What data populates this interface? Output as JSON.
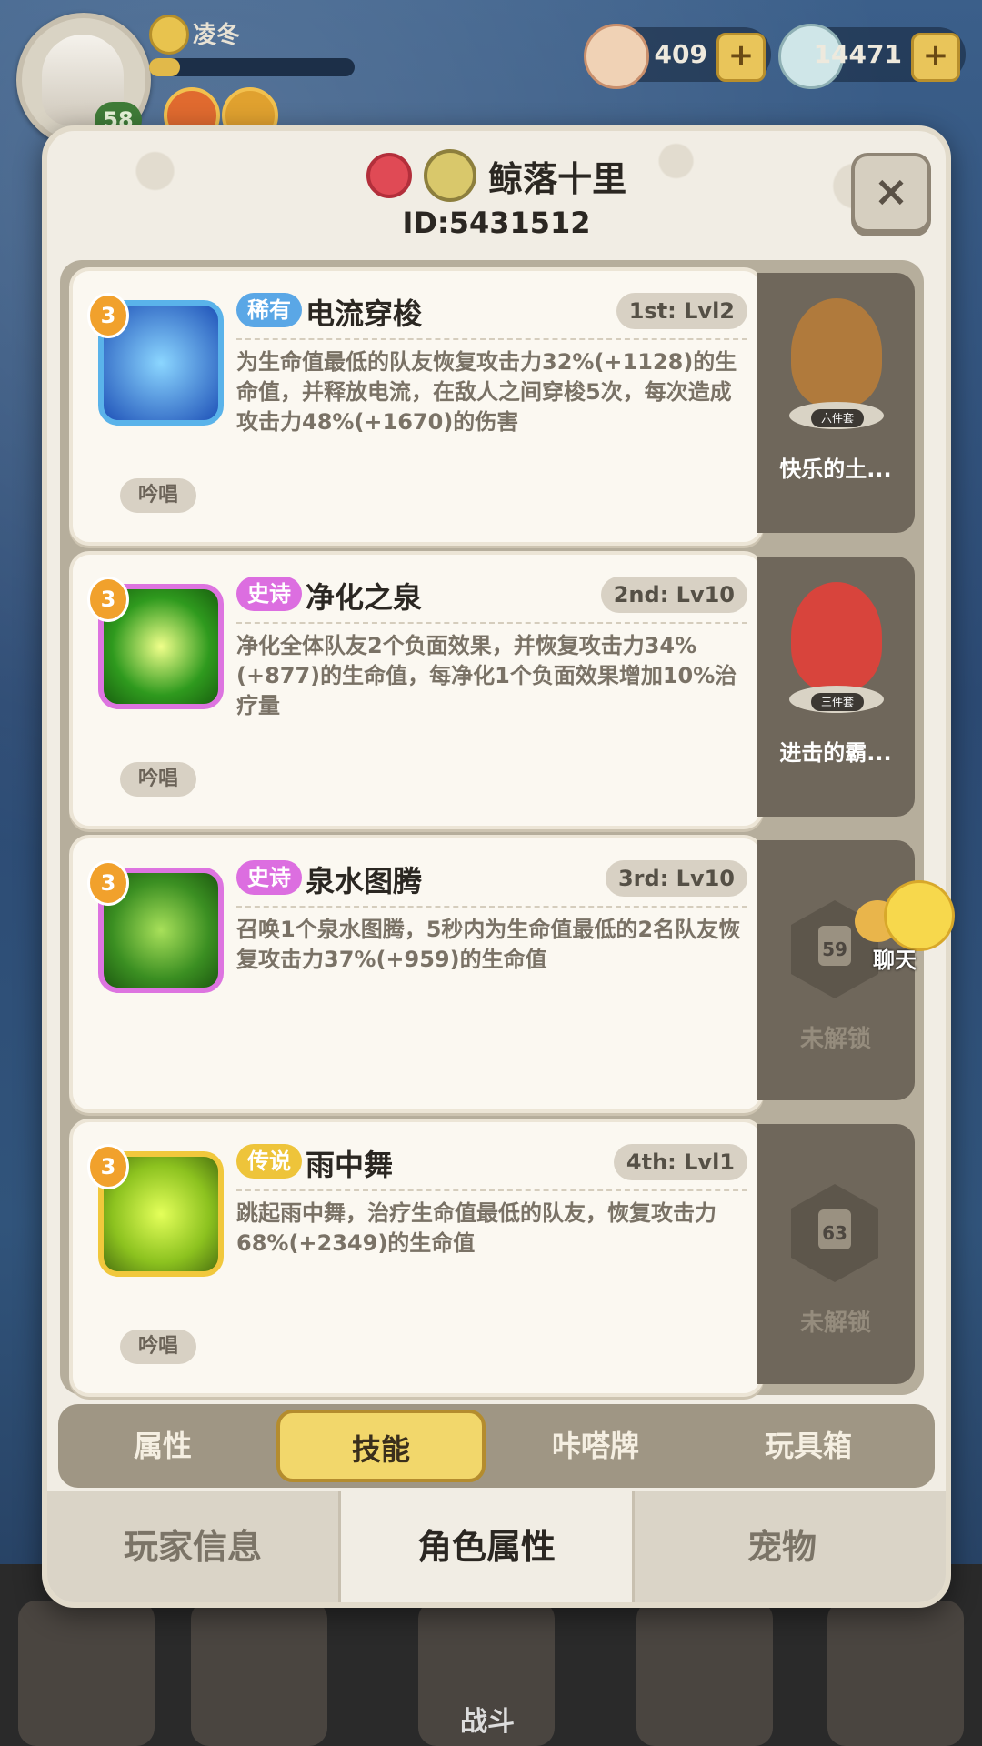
{
  "hud": {
    "player_name": "凌冬",
    "level": "58",
    "level_progress": 0.15,
    "currency1": "409",
    "currency2": "14471",
    "plus": "+"
  },
  "panel": {
    "name": "鲸落十里",
    "id": "ID:5431512",
    "close": "×"
  },
  "skills": [
    {
      "rarity": "稀有",
      "rarity_color": "#5aa7e6",
      "name": "电流穿梭",
      "level": "1st: Lvl2",
      "badge": "3",
      "icon_color": "#2d6fd0",
      "frame_color": "#5ab3ea",
      "desc": "为生命值最低的队友恢复攻击力32%(+1128)的生命值，并释放电流，在敌人之间穿梭5次，每次造成攻击力48%(+1670)的伤害",
      "chant": "吟唱"
    },
    {
      "rarity": "史诗",
      "rarity_color": "#dc6ee0",
      "name": "净化之泉",
      "level": "2nd: Lv10",
      "badge": "3",
      "icon_color": "#3fae2a",
      "frame_color": "#dd74e0",
      "desc": "净化全体队友2个负面效果，并恢复攻击力34%(+877)的生命值，每净化1个负面效果增加10%治疗量",
      "chant": "吟唱"
    },
    {
      "rarity": "史诗",
      "rarity_color": "#dc6ee0",
      "name": "泉水图腾",
      "level": "3rd: Lv10",
      "badge": "3",
      "icon_color": "#4aa32d",
      "frame_color": "#dd74e0",
      "desc": "召唤1个泉水图腾，5秒内为生命值最低的2名队友恢复攻击力37%(+959)的生命值",
      "chant": ""
    },
    {
      "rarity": "传说",
      "rarity_color": "#eec43a",
      "name": "雨中舞",
      "level": "4th: Lvl1",
      "badge": "3",
      "icon_color": "#8cc21f",
      "frame_color": "#f1c83c",
      "desc": "跳起雨中舞，治疗生命值最低的队友，恢复攻击力68%(+2349)的生命值",
      "chant": "吟唱"
    }
  ],
  "sides": [
    {
      "name": "快乐的土...",
      "set": "六件套",
      "color": "#b07a3c"
    },
    {
      "name": "进击的霸...",
      "set": "三件套",
      "color": "#d8443c"
    },
    {
      "locked": "未解锁",
      "unlock_level": "59"
    },
    {
      "locked": "未解锁",
      "unlock_level": "63"
    }
  ],
  "tabs": [
    "属性",
    "技能",
    "咔嗒牌",
    "玩具箱"
  ],
  "bottom_tabs": [
    "玩家信息",
    "角色属性",
    "宠物"
  ],
  "chat_label": "聊天",
  "nav_fight": "战斗"
}
